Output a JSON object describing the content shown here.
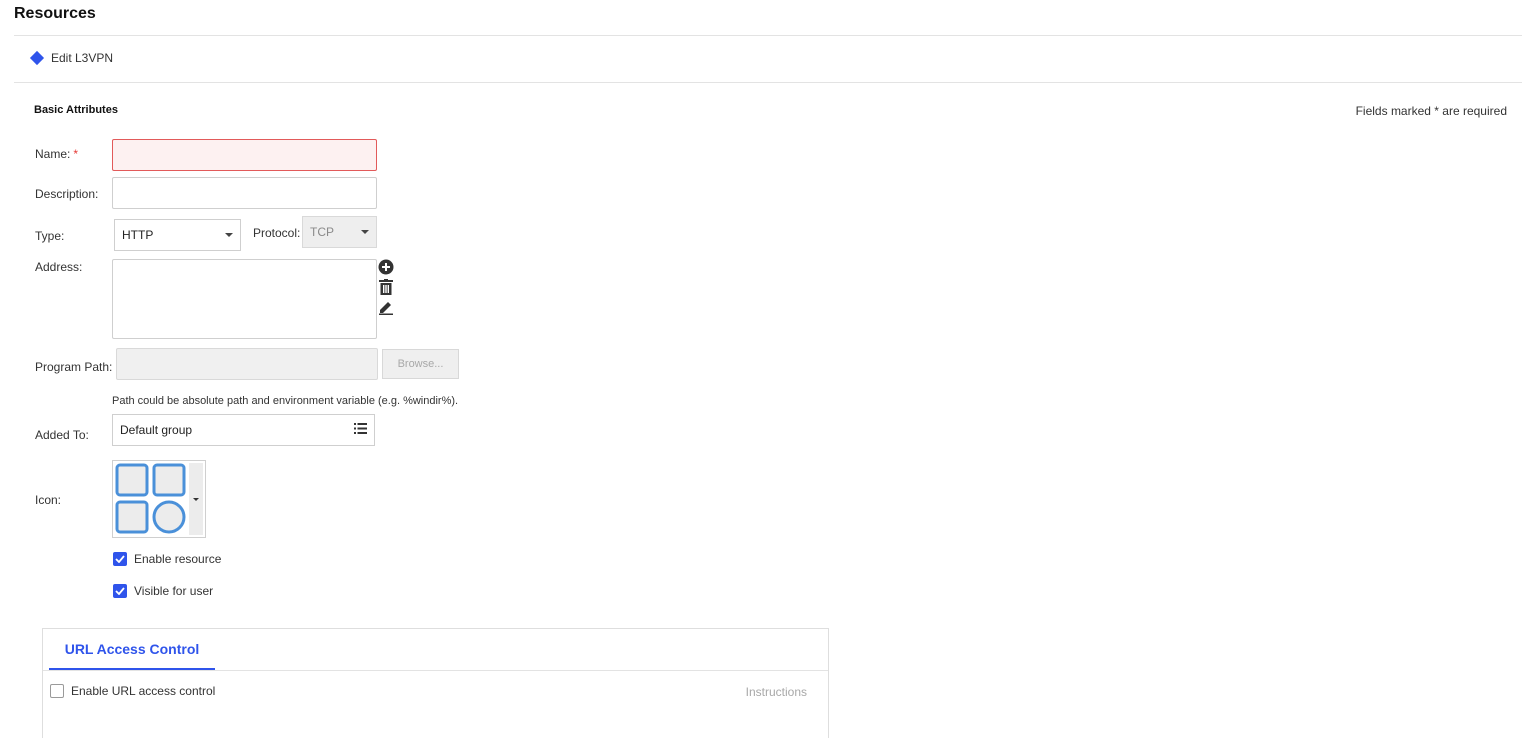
{
  "page": {
    "title": "Resources"
  },
  "breadcrumb": {
    "label": "Edit L3VPN"
  },
  "section": {
    "title": "Basic Attributes",
    "required_note": "Fields marked * are required"
  },
  "form": {
    "name": {
      "label": "Name:",
      "required_mark": "*",
      "value": ""
    },
    "description": {
      "label": "Description:",
      "value": ""
    },
    "type": {
      "label": "Type:",
      "value": "HTTP"
    },
    "protocol": {
      "label": "Protocol:",
      "value": "TCP"
    },
    "address": {
      "label": "Address:",
      "value": ""
    },
    "program_path": {
      "label": "Program Path:",
      "value": "",
      "browse_label": "Browse...",
      "hint": "Path could be absolute path and environment variable (e.g. %windir%)."
    },
    "added_to": {
      "label": "Added To:",
      "value": "Default group"
    },
    "icon": {
      "label": "Icon:"
    },
    "enable_resource": {
      "label": "Enable resource",
      "checked": true
    },
    "visible_for_user": {
      "label": "Visible for user",
      "checked": true
    }
  },
  "url_access": {
    "tab_label": "URL Access Control",
    "enable_label": "Enable URL access control",
    "enable_checked": false,
    "instructions_label": "Instructions"
  },
  "colors": {
    "accent": "#2f54eb",
    "error_border": "#e25a5a",
    "icon_blue": "#4a90d9"
  },
  "icons": {
    "add": "plus-circle-icon",
    "delete": "trash-icon",
    "edit": "pencil-icon",
    "group_list": "list-icon",
    "select_caret": "caret-down-icon"
  }
}
